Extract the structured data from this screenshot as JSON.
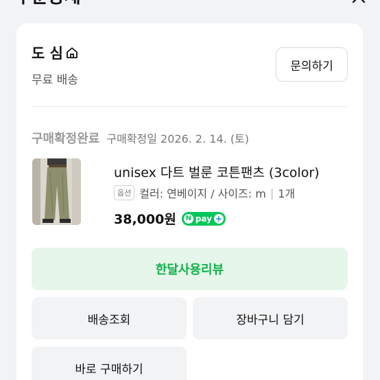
{
  "header": {
    "title": "주문상세"
  },
  "store": {
    "name": "도 심",
    "shipping": "무료 배송",
    "inquiry_label": "문의하기"
  },
  "order": {
    "status": "구매확정완료",
    "status_date": "구매확정일 2026. 2. 14. (토)",
    "product": {
      "name": "unisex 다트 벌룬 코튼팬츠 (3color)",
      "option_badge": "옵션",
      "option_text": "컬러: 연베이지 / 사이즈: m",
      "quantity": "1개",
      "price": "38,000원",
      "npay_label": "pay"
    }
  },
  "buttons": {
    "review": "한달사용리뷰",
    "shipping_track": "배송조회",
    "add_cart": "장바구니 담기",
    "buy_now": "바로 구매하기"
  },
  "colors": {
    "accent_green": "#03c75a",
    "review_bg": "#e6f6ea"
  }
}
